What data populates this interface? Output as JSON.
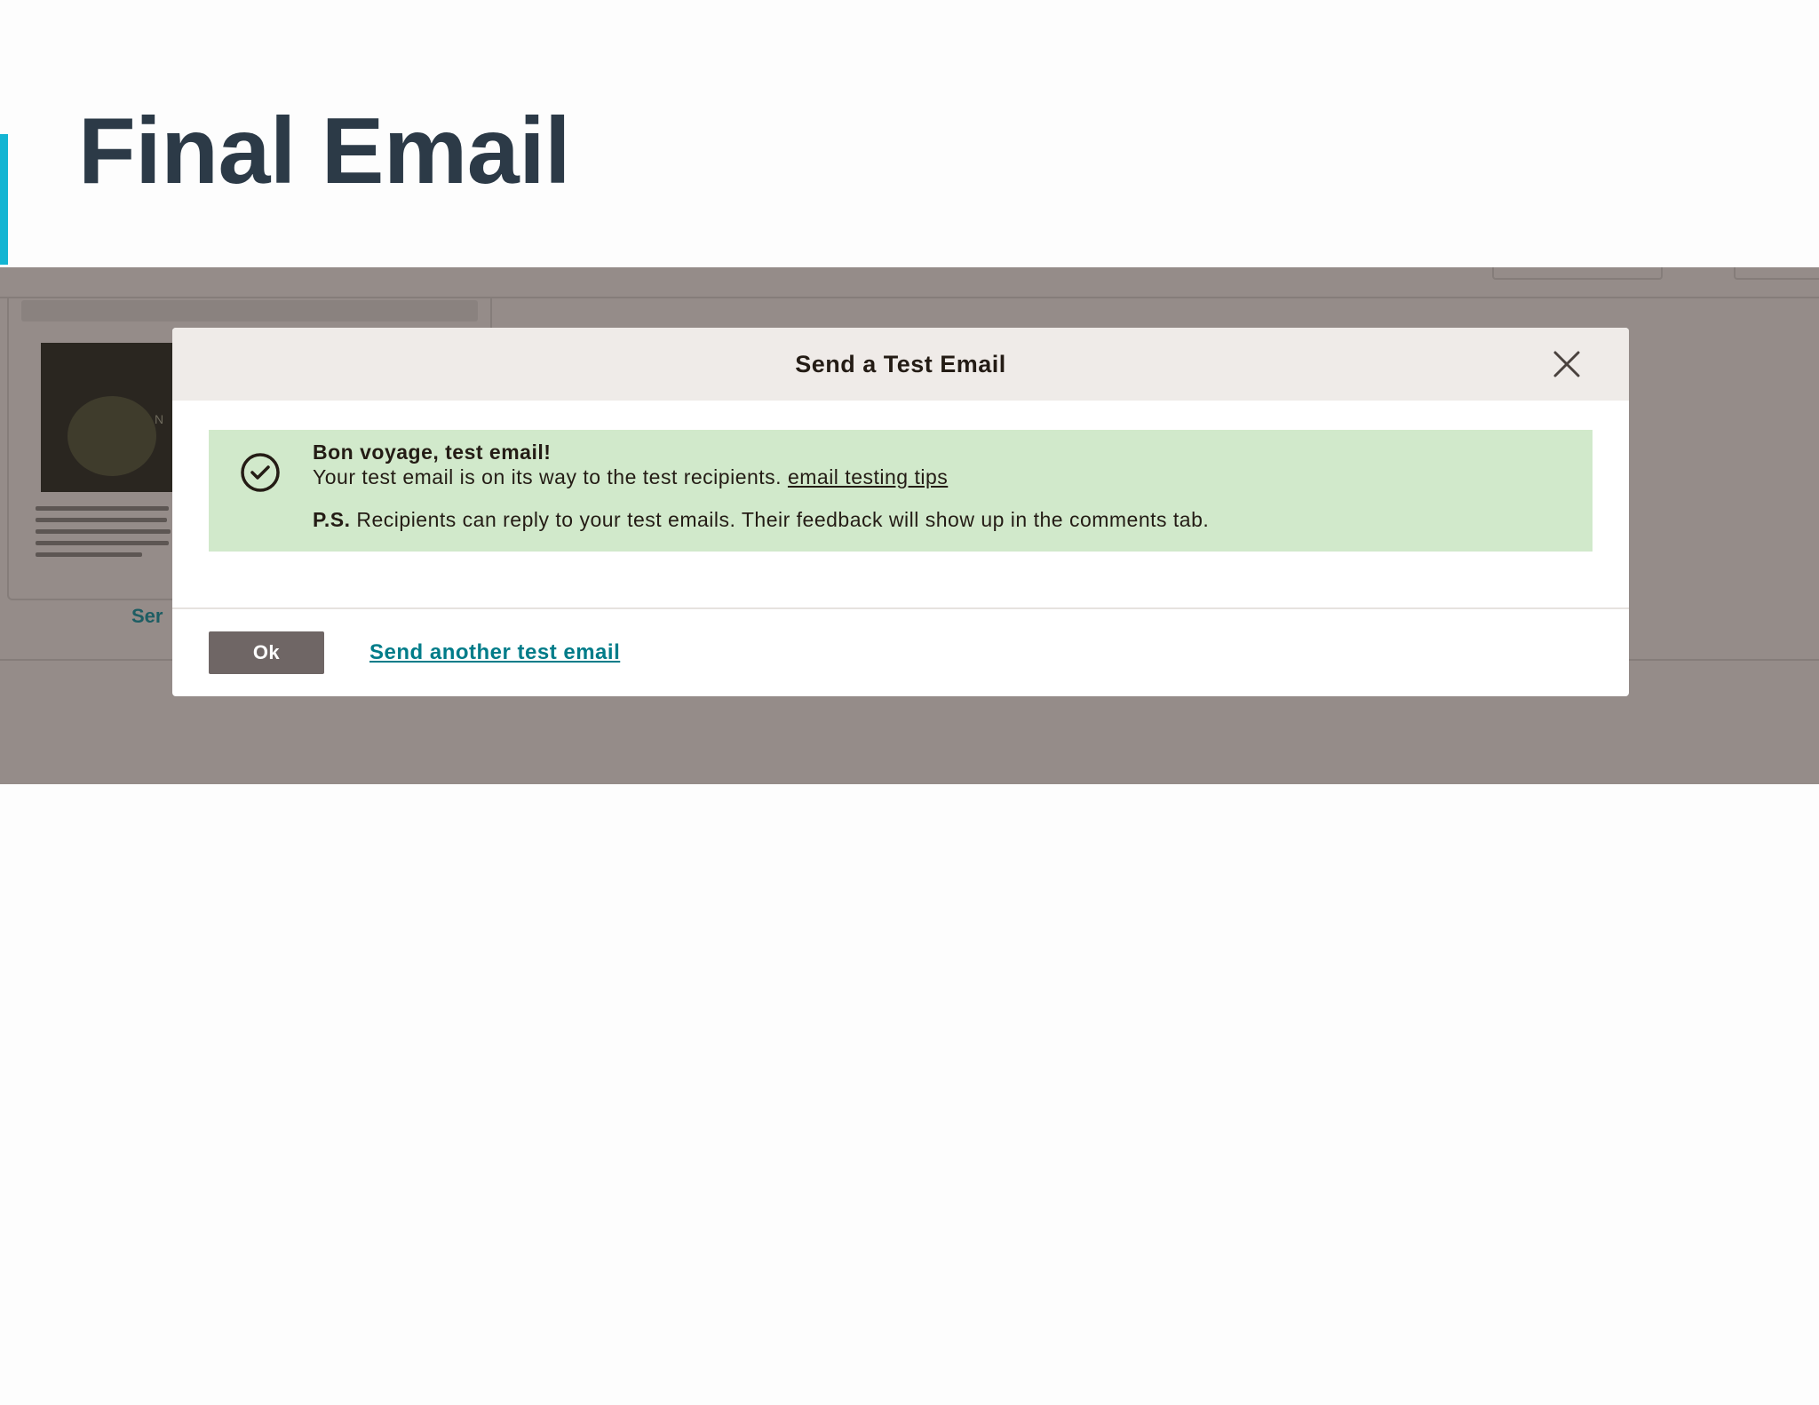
{
  "slide": {
    "title": "Final Email"
  },
  "background": {
    "thumbnail_text": "N",
    "partial_link": "Ser"
  },
  "modal": {
    "title": "Send a Test Email",
    "close_icon": "close-icon",
    "alert": {
      "icon": "check-circle-icon",
      "heading": "Bon voyage, test email!",
      "message": "Your test email is on its way to the test recipients.",
      "tips_link": "email testing tips",
      "ps_label": "P.S.",
      "ps_text": "Recipients can reply to your test emails. Their feedback will show up in the comments tab."
    },
    "footer": {
      "ok_label": "Ok",
      "send_another_label": "Send another test email"
    }
  },
  "colors": {
    "accent": "#13b5d3",
    "title": "#2c3a47",
    "overlay": "#958c89",
    "alert_bg": "#d1e9cb",
    "ok_button": "#6f6665",
    "link": "#007c89"
  }
}
